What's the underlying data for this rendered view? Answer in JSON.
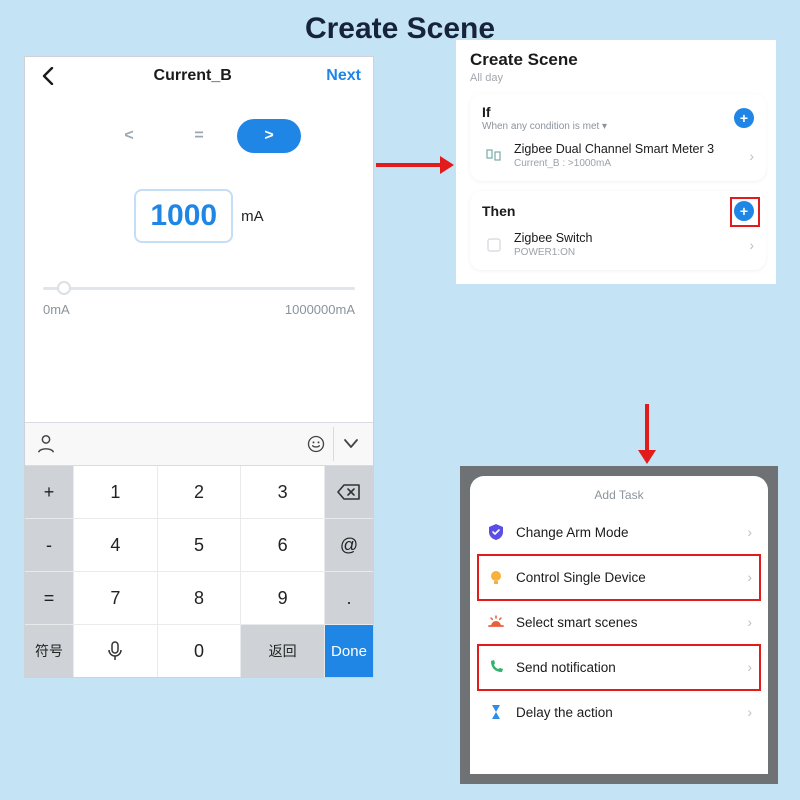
{
  "page": {
    "title": "Create Scene"
  },
  "left": {
    "header": {
      "title": "Current_B",
      "next": "Next"
    },
    "comparators": {
      "lt": "<",
      "eq": "=",
      "gt": ">"
    },
    "value": "1000",
    "unit": "mA",
    "range_min": "0mA",
    "range_max": "1000000mA",
    "keys": {
      "k1": "1",
      "k2": "2",
      "k3": "3",
      "k4": "4",
      "k5": "5",
      "k6": "6",
      "k7": "7",
      "k8": "8",
      "k9": "9",
      "k0": "0",
      "plus": "+",
      "minus": "-",
      "equals": "=",
      "at": "@",
      "dot": ".",
      "symbols": "符号",
      "return": "返回",
      "done": "Done"
    }
  },
  "right_top": {
    "title": "Create Scene",
    "subtitle": "All day",
    "if": {
      "title": "If",
      "subtitle": "When any condition is met ▾",
      "device": "Zigbee Dual Channel Smart Meter 3",
      "detail": "Current_B : >1000mA"
    },
    "then": {
      "title": "Then",
      "device": "Zigbee Switch",
      "detail": "POWER1:ON"
    }
  },
  "right_bottom": {
    "title": "Add Task",
    "rows": {
      "r1": "Change Arm Mode",
      "r2": "Control Single Device",
      "r3": "Select smart scenes",
      "r4": "Send notification",
      "r5": "Delay the action"
    }
  }
}
